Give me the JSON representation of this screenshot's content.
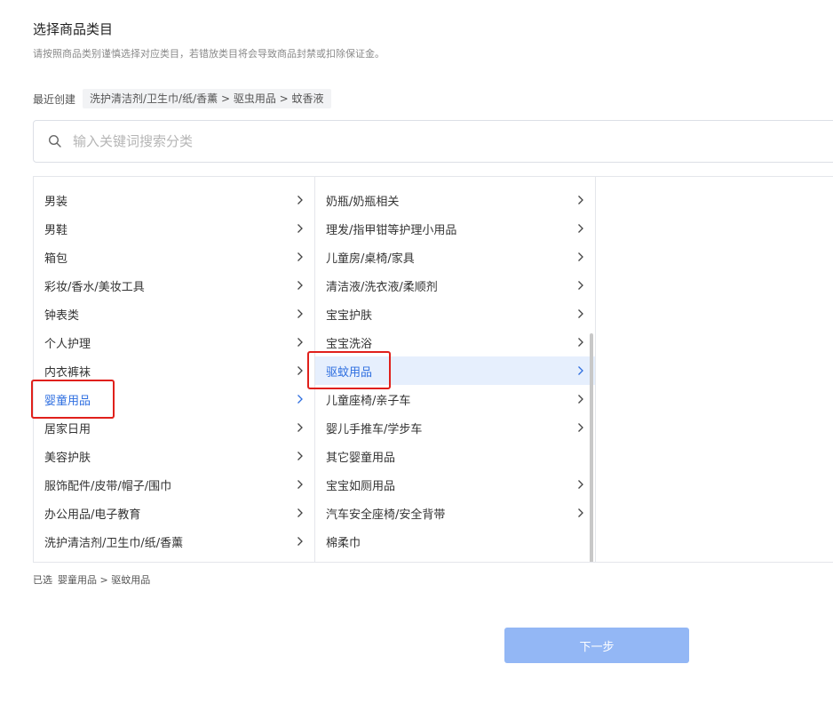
{
  "header": {
    "title": "选择商品类目",
    "subtitle": "请按照商品类别谨慎选择对应类目，若错放类目将会导致商品封禁或扣除保证金。"
  },
  "recent": {
    "label": "最近创建",
    "chip": "洗护清洁剂/卫生巾/纸/香薰 > 驱虫用品 > 蚊香液"
  },
  "search": {
    "placeholder": "输入关键词搜索分类",
    "value": "",
    "icon": "search-icon"
  },
  "columns": {
    "level1": [
      {
        "label": "男装",
        "has_children": true
      },
      {
        "label": "男鞋",
        "has_children": true
      },
      {
        "label": "箱包",
        "has_children": true
      },
      {
        "label": "彩妆/香水/美妆工具",
        "has_children": true
      },
      {
        "label": "钟表类",
        "has_children": true
      },
      {
        "label": "个人护理",
        "has_children": true
      },
      {
        "label": "内衣裤袜",
        "has_children": true
      },
      {
        "label": "婴童用品",
        "has_children": true,
        "selected": true
      },
      {
        "label": "居家日用",
        "has_children": true
      },
      {
        "label": "美容护肤",
        "has_children": true
      },
      {
        "label": "服饰配件/皮带/帽子/围巾",
        "has_children": true
      },
      {
        "label": "办公用品/电子教育",
        "has_children": true
      },
      {
        "label": "洗护清洁剂/卫生巾/纸/香薰",
        "has_children": true
      }
    ],
    "level2": [
      {
        "label": "奶瓶/奶瓶相关",
        "has_children": true
      },
      {
        "label": "理发/指甲钳等护理小用品",
        "has_children": true
      },
      {
        "label": "儿童房/桌椅/家具",
        "has_children": true
      },
      {
        "label": "清洁液/洗衣液/柔顺剂",
        "has_children": true
      },
      {
        "label": "宝宝护肤",
        "has_children": true
      },
      {
        "label": "宝宝洗浴",
        "has_children": true
      },
      {
        "label": "驱蚊用品",
        "has_children": true,
        "selected": true
      },
      {
        "label": "儿童座椅/亲子车",
        "has_children": true
      },
      {
        "label": "婴儿手推车/学步车",
        "has_children": true
      },
      {
        "label": "其它婴童用品",
        "has_children": false
      },
      {
        "label": "宝宝如厕用品",
        "has_children": true
      },
      {
        "label": "汽车安全座椅/安全背带",
        "has_children": true
      },
      {
        "label": "棉柔巾",
        "has_children": false
      }
    ]
  },
  "selected_path": {
    "label": "已选",
    "path": "婴童用品 > 驱蚊用品"
  },
  "footer": {
    "next_label": "下一步"
  },
  "colors": {
    "accent": "#2f6fe0",
    "highlight_bg": "#e6effd",
    "button_bg": "#93b7f5",
    "annotation_red": "#e0201b"
  }
}
